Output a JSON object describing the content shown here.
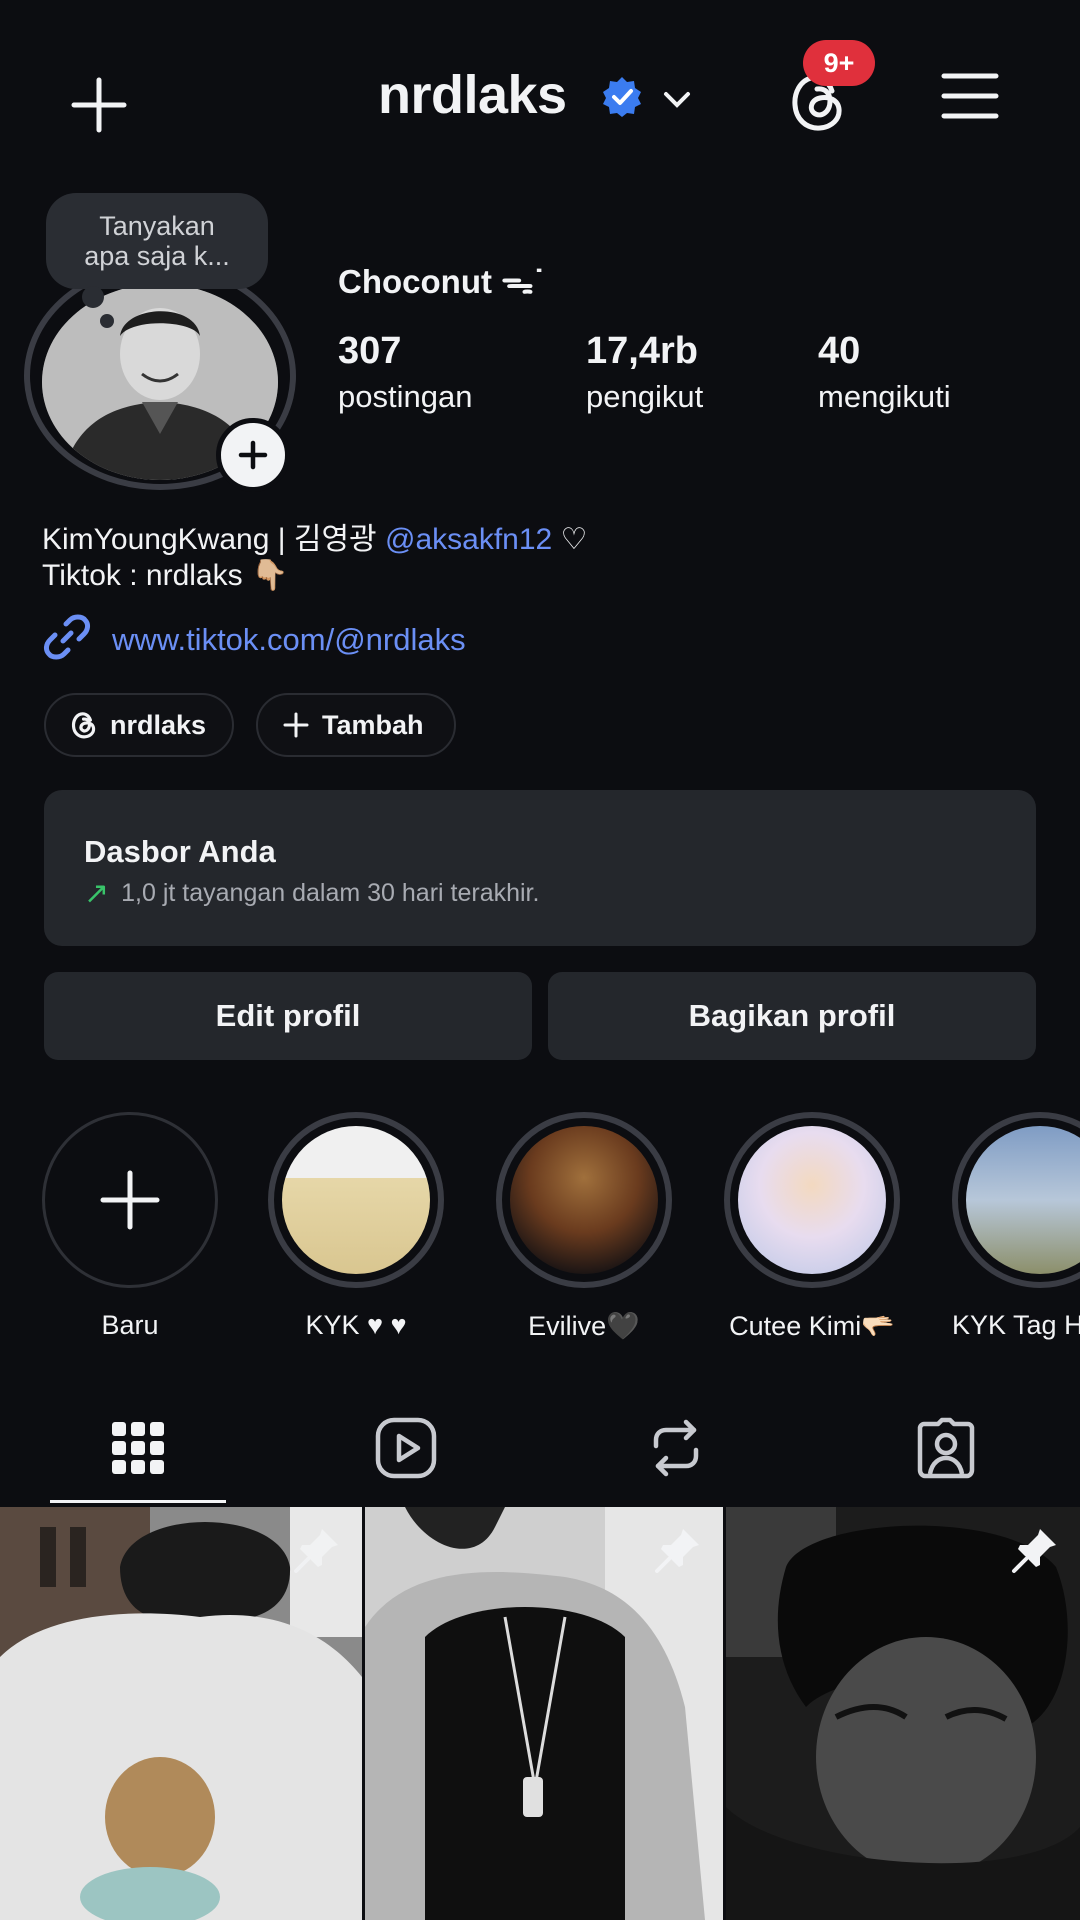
{
  "header": {
    "username": "nrdlaks",
    "notification_badge": "9+"
  },
  "profile": {
    "note_bubble": [
      "Tanyakan",
      "apa saja k..."
    ],
    "display_name": "Choconut ᯓ˙",
    "stats": [
      {
        "value": "307",
        "label": "postingan"
      },
      {
        "value": "17,4rb",
        "label": "pengikut"
      },
      {
        "value": "40",
        "label": "mengikuti"
      }
    ],
    "bio_line1_text": "KimYoungKwang | 김영광 ",
    "bio_line1_mention": "@aksakfn12",
    "bio_line1_suffix": " ♡",
    "bio_line2": "Tiktok : nrdlaks  👇🏼",
    "link": "www.tiktok.com/@nrdlaks",
    "chips": {
      "threads": "nrdlaks",
      "add": "Tambah"
    }
  },
  "dashboard": {
    "title": "Dasbor Anda",
    "subtitle": "1,0 jt tayangan dalam 30 hari terakhir."
  },
  "buttons": {
    "edit": "Edit profil",
    "share": "Bagikan profil"
  },
  "highlights": [
    {
      "label": "Baru"
    },
    {
      "label": "KYK ♥ ♥"
    },
    {
      "label": "Evilive🖤"
    },
    {
      "label": "Cutee Kimi🫳🏻"
    },
    {
      "label": "KYK Tag H"
    }
  ],
  "colors": {
    "background": "#0c0d11",
    "card": "#24272c",
    "link_blue": "#6b8ff5",
    "verified_blue": "#3b7cf0",
    "badge_red": "#e0303c",
    "trend_green": "#39c46a"
  }
}
